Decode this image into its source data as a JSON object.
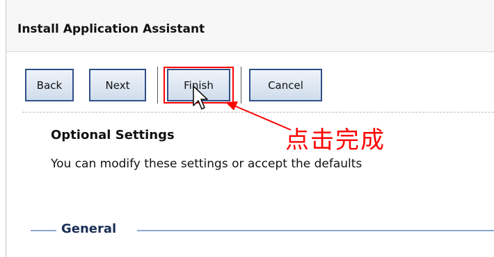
{
  "header": {
    "title": "Install Application Assistant"
  },
  "toolbar": {
    "back_label": "Back",
    "next_label": "Next",
    "finish_label": "Finish",
    "cancel_label": "Cancel"
  },
  "annotation": {
    "text": "点击完成",
    "color": "#ff0000"
  },
  "section": {
    "title": "Optional Settings",
    "description": "You can modify these settings or accept the defaults"
  },
  "fieldset": {
    "legend": "General"
  },
  "colors": {
    "button_border": "#2f4f86",
    "button_fill": "#cfdcec",
    "highlight": "#ff0000",
    "fieldset_line": "#8aa6cf"
  },
  "icons": [
    "mouse-cursor-icon",
    "annotation-arrow-icon"
  ]
}
